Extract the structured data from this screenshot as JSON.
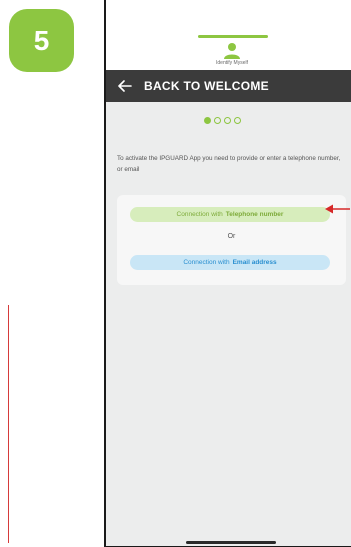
{
  "step": {
    "number": "5"
  },
  "header": {
    "back_label": "BACK TO WELCOME"
  },
  "top": {
    "profile_caption": "Identify Myself"
  },
  "progress": {
    "total_steps": 4,
    "current_step": 1
  },
  "instruction": {
    "text": "To activate the IPGUARD App you need to provide or enter a telephone number, or email"
  },
  "options": {
    "telephone_prefix": "Connection with",
    "telephone_strong": "Telephone number",
    "or_label": "Or",
    "email_prefix": "Connection with",
    "email_strong": "Email address"
  },
  "colors": {
    "step_badge": "#8dc641",
    "header_bg": "#3b3b3b",
    "accent_green": "#8dc641",
    "telephone_button_bg": "#d7edbc",
    "email_button_bg": "#c9e6f6",
    "annotation_red": "#d62828"
  },
  "icons": {
    "back": "arrow-left-icon",
    "profile": "person-icon",
    "annotation": "red-arrow-icon"
  }
}
